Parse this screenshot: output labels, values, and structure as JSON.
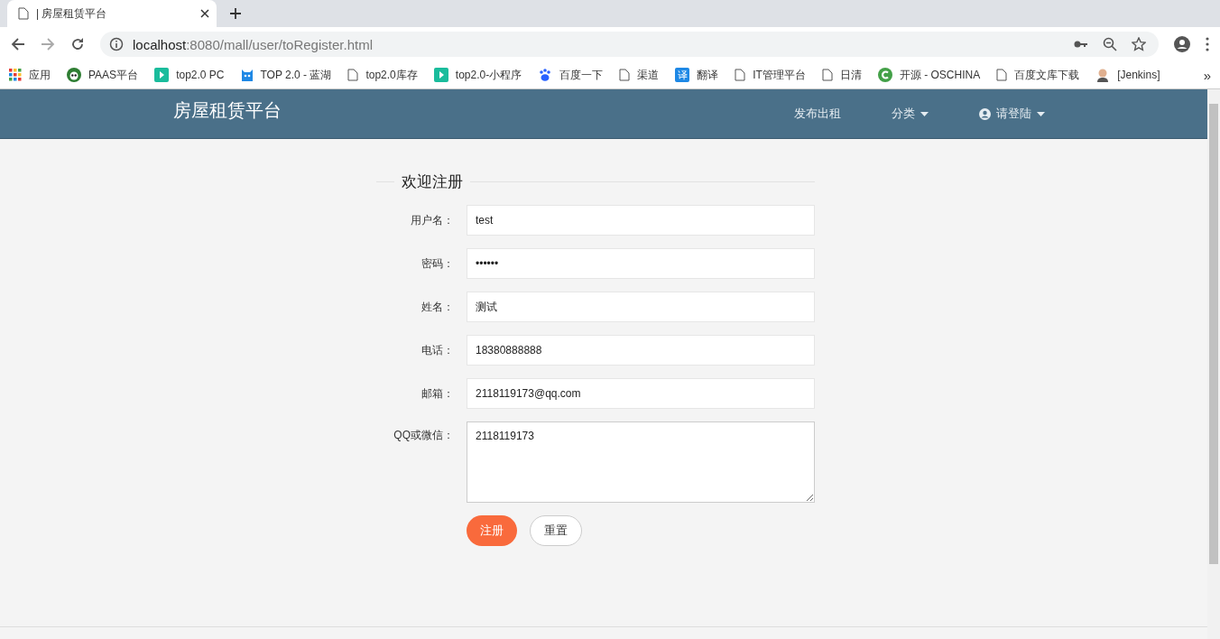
{
  "browser": {
    "tab_title": "| 房屋租赁平台",
    "url_host": "localhost",
    "url_path": ":8080/mall/user/toRegister.html",
    "bookmarks": [
      {
        "label": "应用",
        "kind": "apps"
      },
      {
        "label": "PAAS平台",
        "kind": "panda"
      },
      {
        "label": "top2.0 PC",
        "kind": "play"
      },
      {
        "label": "TOP 2.0 - 蓝湖",
        "kind": "lanhu"
      },
      {
        "label": "top2.0库存",
        "kind": "page"
      },
      {
        "label": "top2.0-小程序",
        "kind": "play"
      },
      {
        "label": "百度一下",
        "kind": "paw"
      },
      {
        "label": "渠道",
        "kind": "page"
      },
      {
        "label": "翻译",
        "kind": "translate"
      },
      {
        "label": "IT管理平台",
        "kind": "page"
      },
      {
        "label": "日清",
        "kind": "page"
      },
      {
        "label": "开源 - OSCHINA",
        "kind": "oschina"
      },
      {
        "label": "百度文库下载",
        "kind": "page"
      },
      {
        "label": "[Jenkins]",
        "kind": "jenkins"
      }
    ],
    "translate_glyph": "译",
    "more": "»"
  },
  "header": {
    "brand": "房屋租赁平台",
    "nav": [
      {
        "label": "发布出租",
        "dropdown": false,
        "user_icon": false
      },
      {
        "label": "分类",
        "dropdown": true,
        "user_icon": false
      },
      {
        "label": "请登陆",
        "dropdown": true,
        "user_icon": true
      }
    ]
  },
  "form": {
    "legend": "欢迎注册",
    "fields": [
      {
        "label": "用户名：",
        "value": "test",
        "kind": "input"
      },
      {
        "label": "密码：",
        "value": "••••••",
        "kind": "input"
      },
      {
        "label": "姓名：",
        "value": "测试",
        "kind": "input"
      },
      {
        "label": "电话：",
        "value": "18380888888",
        "kind": "input"
      },
      {
        "label": "邮箱：",
        "value": "2118119173@qq.com",
        "kind": "input"
      },
      {
        "label": "QQ或微信：",
        "value": "2118119173",
        "kind": "textarea"
      }
    ],
    "buttons": [
      {
        "label": "注册",
        "kind": "primary"
      },
      {
        "label": "重置",
        "kind": "secondary"
      }
    ]
  }
}
